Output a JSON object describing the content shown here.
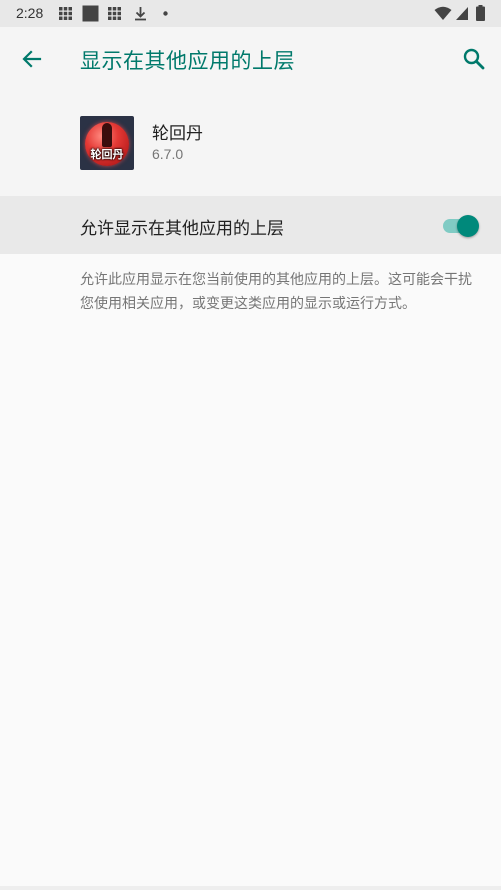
{
  "status_bar": {
    "time": "2:28",
    "icons_left": [
      "grid-icon",
      "square-icon",
      "grid-icon",
      "download-icon",
      "dot-icon"
    ],
    "icons_right": [
      "wifi-icon",
      "signal-icon",
      "battery-icon"
    ]
  },
  "app_bar": {
    "title": "显示在其他应用的上层",
    "accent_color": "#00796b"
  },
  "app": {
    "name": "轮回丹",
    "version": "6.7.0",
    "icon_text": "轮回丹"
  },
  "setting": {
    "label": "允许显示在其他应用的上层",
    "enabled": true,
    "description": "允许此应用显示在您当前使用的其他应用的上层。这可能会干扰您使用相关应用，或变更这类应用的显示或运行方式。"
  }
}
